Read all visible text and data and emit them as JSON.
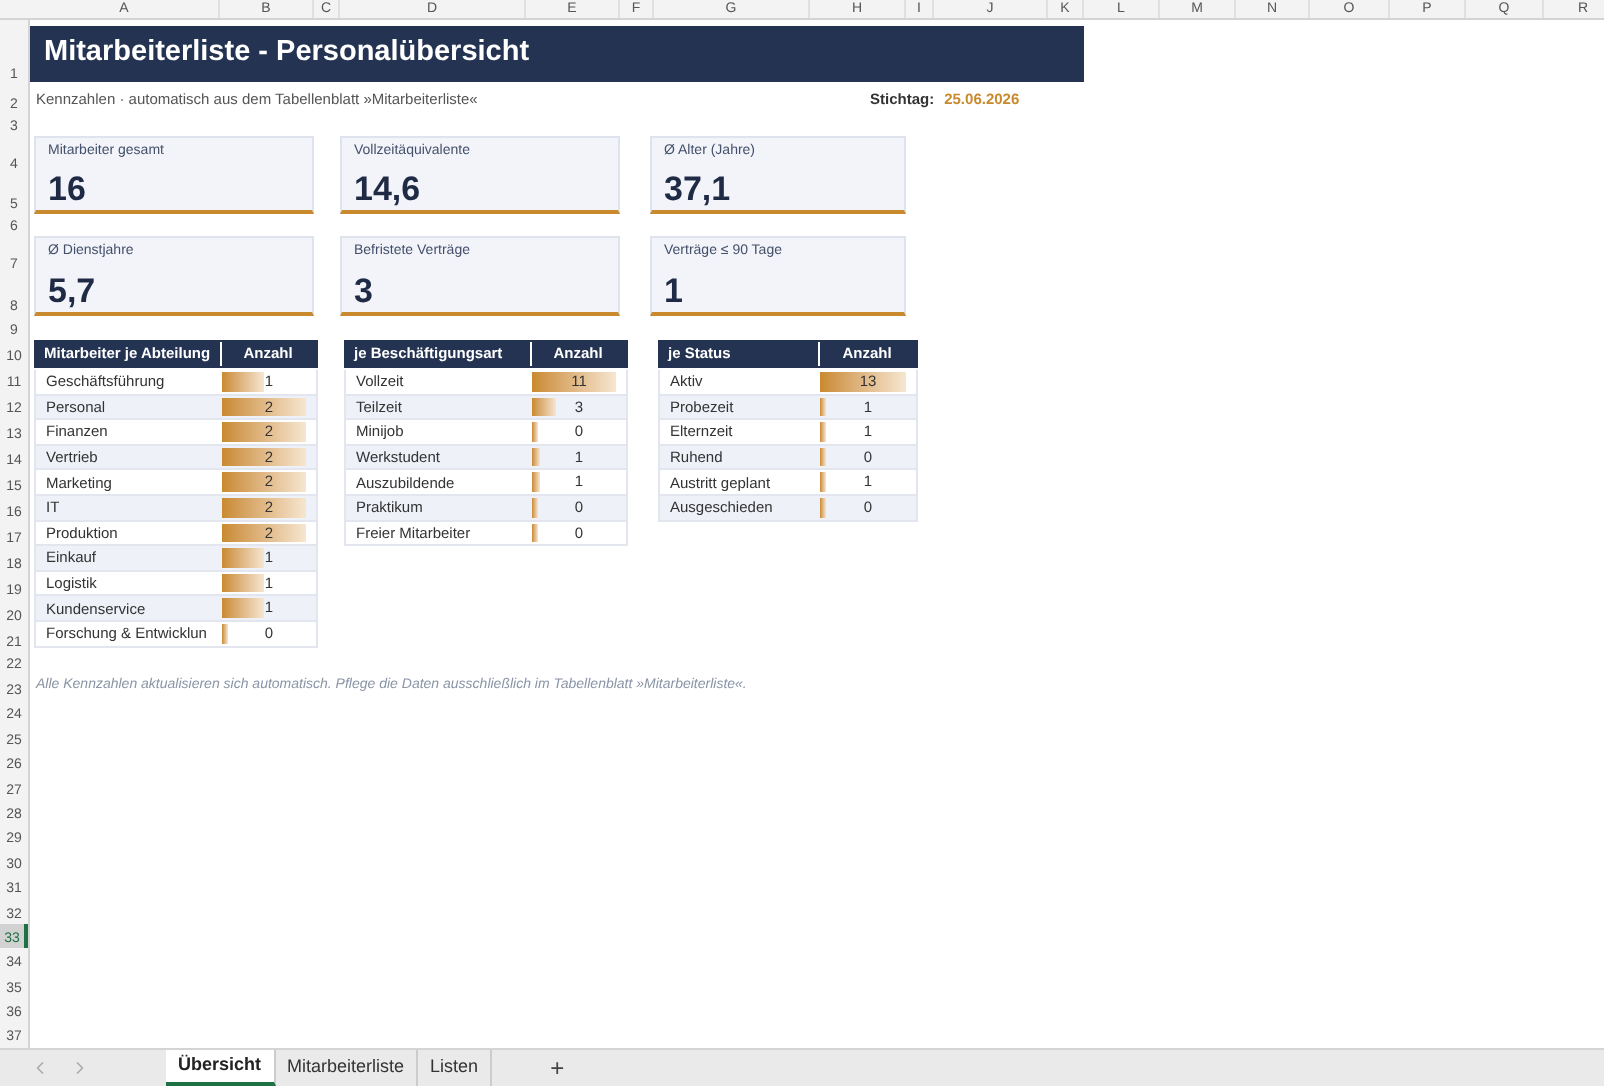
{
  "columns": [
    "A",
    "B",
    "C",
    "D",
    "E",
    "F",
    "G",
    "H",
    "I",
    "J",
    "K",
    "L",
    "M",
    "N",
    "O",
    "P",
    "Q",
    "R"
  ],
  "rows": [
    {
      "label": "1",
      "selected": false
    },
    {
      "label": "2",
      "selected": false
    },
    {
      "label": "3",
      "selected": false
    },
    {
      "label": "4",
      "selected": false
    },
    {
      "label": "5",
      "selected": false
    },
    {
      "label": "6",
      "selected": false
    },
    {
      "label": "7",
      "selected": false
    },
    {
      "label": "8",
      "selected": false
    },
    {
      "label": "9",
      "selected": false
    },
    {
      "label": "10",
      "selected": false
    },
    {
      "label": "11",
      "selected": false
    },
    {
      "label": "12",
      "selected": false
    },
    {
      "label": "13",
      "selected": false
    },
    {
      "label": "14",
      "selected": false
    },
    {
      "label": "15",
      "selected": false
    },
    {
      "label": "16",
      "selected": false
    },
    {
      "label": "17",
      "selected": false
    },
    {
      "label": "18",
      "selected": false
    },
    {
      "label": "19",
      "selected": false
    },
    {
      "label": "20",
      "selected": false
    },
    {
      "label": "21",
      "selected": false
    },
    {
      "label": "22",
      "selected": false
    },
    {
      "label": "23",
      "selected": false
    },
    {
      "label": "24",
      "selected": false
    },
    {
      "label": "25",
      "selected": false
    },
    {
      "label": "26",
      "selected": false
    },
    {
      "label": "27",
      "selected": false
    },
    {
      "label": "28",
      "selected": false
    },
    {
      "label": "29",
      "selected": false
    },
    {
      "label": "30",
      "selected": false
    },
    {
      "label": "31",
      "selected": false
    },
    {
      "label": "32",
      "selected": false
    },
    {
      "label": "33",
      "selected": true
    },
    {
      "label": "34",
      "selected": false
    },
    {
      "label": "35",
      "selected": false
    },
    {
      "label": "36",
      "selected": false
    },
    {
      "label": "37",
      "selected": false
    }
  ],
  "title": "Mitarbeiterliste - Personalübersicht",
  "subtitle": "Kennzahlen · automatisch aus dem Tabellenblatt »Mitarbeiterliste«",
  "reference_date": {
    "label": "Stichtag:",
    "value": "25.06.2026"
  },
  "kpis": [
    {
      "label": "Mitarbeiter gesamt",
      "value": "16"
    },
    {
      "label": "Vollzeitäquivalente",
      "value": "14,6"
    },
    {
      "label": "Ø Alter (Jahre)",
      "value": "37,1"
    },
    {
      "label": "Ø Dienstjahre",
      "value": "5,7"
    },
    {
      "label": "Befristete Verträge",
      "value": "3"
    },
    {
      "label": "Verträge ≤ 90 Tage",
      "value": "1"
    }
  ],
  "tables": [
    {
      "header": [
        "Mitarbeiter je Abteilung",
        "Anzahl"
      ],
      "rows": [
        {
          "label": "Geschäftsführung",
          "count": "1"
        },
        {
          "label": "Personal",
          "count": "2"
        },
        {
          "label": "Finanzen",
          "count": "2"
        },
        {
          "label": "Vertrieb",
          "count": "2"
        },
        {
          "label": "Marketing",
          "count": "2"
        },
        {
          "label": "IT",
          "count": "2"
        },
        {
          "label": "Produktion",
          "count": "2"
        },
        {
          "label": "Einkauf",
          "count": "1"
        },
        {
          "label": "Logistik",
          "count": "1"
        },
        {
          "label": "Kundenservice",
          "count": "1"
        },
        {
          "label": "Forschung & Entwicklun",
          "count": "0"
        }
      ]
    },
    {
      "header": [
        "je Beschäftigungsart",
        "Anzahl"
      ],
      "rows": [
        {
          "label": "Vollzeit",
          "count": "11"
        },
        {
          "label": "Teilzeit",
          "count": "3"
        },
        {
          "label": "Minijob",
          "count": "0"
        },
        {
          "label": "Werkstudent",
          "count": "1"
        },
        {
          "label": "Auszubildende",
          "count": "1"
        },
        {
          "label": "Praktikum",
          "count": "0"
        },
        {
          "label": "Freier Mitarbeiter",
          "count": "0"
        }
      ]
    },
    {
      "header": [
        "je Status",
        "Anzahl"
      ],
      "rows": [
        {
          "label": "Aktiv",
          "count": "13"
        },
        {
          "label": "Probezeit",
          "count": "1"
        },
        {
          "label": "Elternzeit",
          "count": "1"
        },
        {
          "label": "Ruhend",
          "count": "0"
        },
        {
          "label": "Austritt geplant",
          "count": "1"
        },
        {
          "label": "Ausgeschieden",
          "count": "0"
        }
      ]
    }
  ],
  "note": "Alle Kennzahlen aktualisieren sich automatisch. Pflege die Daten ausschließlich im Tabellenblatt »Mitarbeiterliste«.",
  "sheet_tabs": [
    {
      "label": "Übersicht",
      "selected": true
    },
    {
      "label": "Mitarbeiterliste",
      "selected": false
    },
    {
      "label": "Listen",
      "selected": false
    }
  ],
  "add_sheet": "+"
}
